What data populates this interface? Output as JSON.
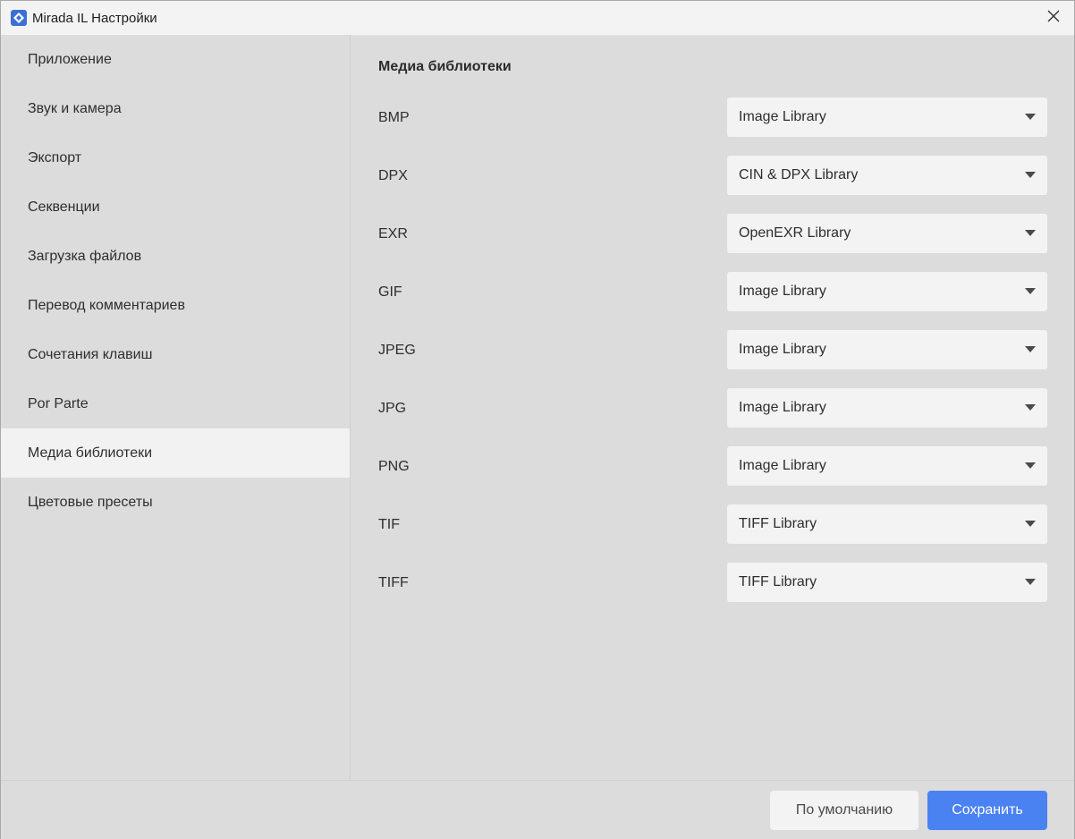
{
  "window": {
    "title": "Mirada IL Настройки"
  },
  "sidebar": {
    "items": [
      {
        "label": "Приложение",
        "active": false
      },
      {
        "label": "Звук и камера",
        "active": false
      },
      {
        "label": "Экспорт",
        "active": false
      },
      {
        "label": "Секвенции",
        "active": false
      },
      {
        "label": "Загрузка файлов",
        "active": false
      },
      {
        "label": "Перевод комментариев",
        "active": false
      },
      {
        "label": "Сочетания клавиш",
        "active": false
      },
      {
        "label": "Por Parte",
        "active": false
      },
      {
        "label": "Медиа библиотеки",
        "active": true
      },
      {
        "label": "Цветовые пресеты",
        "active": false
      }
    ]
  },
  "content": {
    "title": "Медиа библиотеки",
    "rows": [
      {
        "format": "BMP",
        "library": "Image Library"
      },
      {
        "format": "DPX",
        "library": "CIN & DPX Library"
      },
      {
        "format": "EXR",
        "library": "OpenEXR Library"
      },
      {
        "format": "GIF",
        "library": "Image Library"
      },
      {
        "format": "JPEG",
        "library": "Image Library"
      },
      {
        "format": "JPG",
        "library": "Image Library"
      },
      {
        "format": "PNG",
        "library": "Image Library"
      },
      {
        "format": "TIF",
        "library": "TIFF Library"
      },
      {
        "format": "TIFF",
        "library": "TIFF Library"
      }
    ]
  },
  "footer": {
    "default_label": "По умолчанию",
    "save_label": "Сохранить"
  },
  "colors": {
    "accent": "#4b82f2",
    "background": "#dcdcdc",
    "active_item": "#f2f2f2",
    "select_bg": "#f3f3f3"
  },
  "icons": {
    "app": "app-logo-icon",
    "close": "close-icon",
    "dropdown": "chevron-down-icon"
  }
}
